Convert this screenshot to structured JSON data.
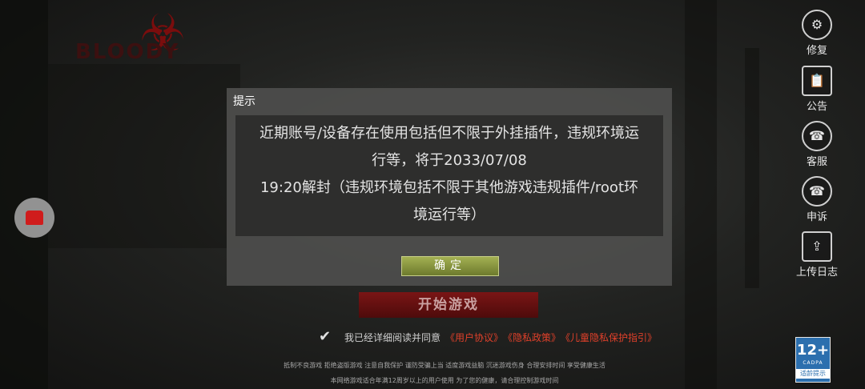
{
  "brand": {
    "logo_text": "BLOODY",
    "logo_subtext": ""
  },
  "side_menu": [
    {
      "label": "修复",
      "icon": "gear-icon",
      "glyph": "⚙"
    },
    {
      "label": "公告",
      "icon": "notice-icon",
      "glyph": "📋"
    },
    {
      "label": "客服",
      "icon": "headset-icon",
      "glyph": "☎"
    },
    {
      "label": "申诉",
      "icon": "appeal-headset-icon",
      "glyph": "☎"
    },
    {
      "label": "上传日志",
      "icon": "upload-icon",
      "glyph": "⇪"
    }
  ],
  "dialog": {
    "title": "提示",
    "line1": "近期账号/设备存在使用包括但不限于外挂插件，违规环境运",
    "line2": "行等，将于2033/07/08",
    "line3": "19:20解封（违规环境包括不限于其他游戏违规插件/root环",
    "line4": "境运行等）",
    "ok_label": "确定"
  },
  "start_button": {
    "label": "开始游戏"
  },
  "agreement": {
    "text": "我已经详细阅读并同意",
    "link1": "《用户协议》",
    "link2": "《隐私政策》",
    "link3": "《儿童隐私保护指引》",
    "checked": true
  },
  "footer": {
    "line1": "抵制不良游戏  拒绝盗版游戏  注意自我保护  谨防受骗上当  适度游戏益脑  沉迷游戏伤身  合理安排时间  享受健康生活",
    "line2": "本网络游戏适合年满12周岁以上的用户使用    为了您的健康，请合理控制游戏时间"
  },
  "age_rating": {
    "number": "12+",
    "org": "CADPA",
    "label": "适龄提示",
    "color": "#2c6fae"
  },
  "colors": {
    "accent_red": "#e0402a",
    "ok_green": "#8f9c40"
  }
}
